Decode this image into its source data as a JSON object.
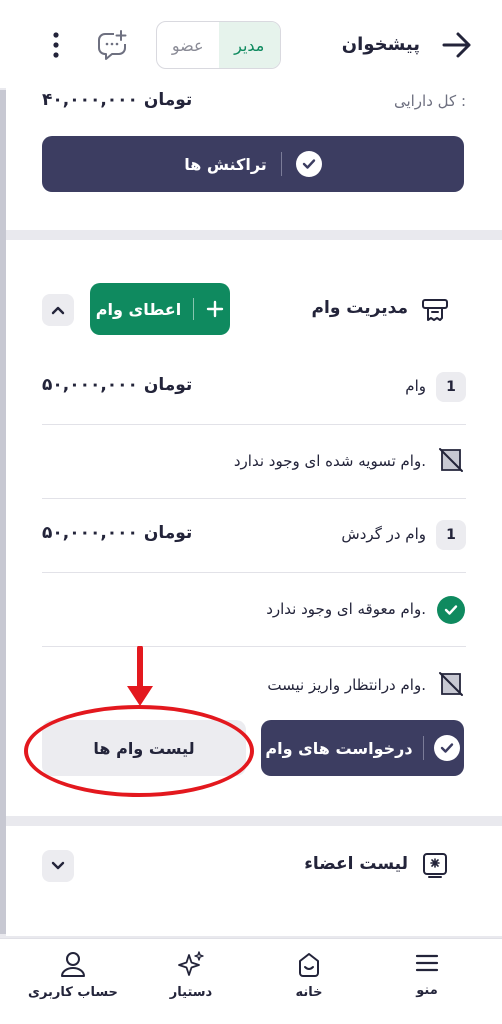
{
  "header": {
    "title": "پیشخوان",
    "segments": [
      "مدیر",
      "عضو"
    ],
    "active_segment": "مدیر"
  },
  "balance": {
    "label": "کل دارایی :",
    "value": "۴۰,۰۰۰,۰۰۰ تومان",
    "transactions_button": "تراکنش ها"
  },
  "loan_management": {
    "title": "مدیریت وام",
    "grant_button": "اعطای وام",
    "rows": [
      {
        "badge": "1",
        "label": "وام",
        "amount": "۵۰,۰۰۰,۰۰۰ تومان"
      },
      {
        "label": "وام تسویه شده ای وجود ندارد."
      },
      {
        "badge": "1",
        "label": "وام در گردش",
        "amount": "۵۰,۰۰۰,۰۰۰ تومان"
      },
      {
        "label": "وام معوقه ای وجود ندارد."
      },
      {
        "label": "وام درانتظار واریز نیست."
      }
    ],
    "requests_button": "درخواست های وام",
    "list_button": "لیست وام ها"
  },
  "members": {
    "title": "لیست اعضاء"
  },
  "bottom_nav": [
    {
      "label": "منو",
      "icon": "menu-icon"
    },
    {
      "label": "خانه",
      "icon": "home-icon"
    },
    {
      "label": "دستیار",
      "icon": "sparkle-icon"
    },
    {
      "label": "حساب کاربری",
      "icon": "user-icon"
    }
  ],
  "colors": {
    "primary_dark": "#3c3d61",
    "accent_green": "#0f8a5f",
    "annotation_red": "#e3181e"
  }
}
